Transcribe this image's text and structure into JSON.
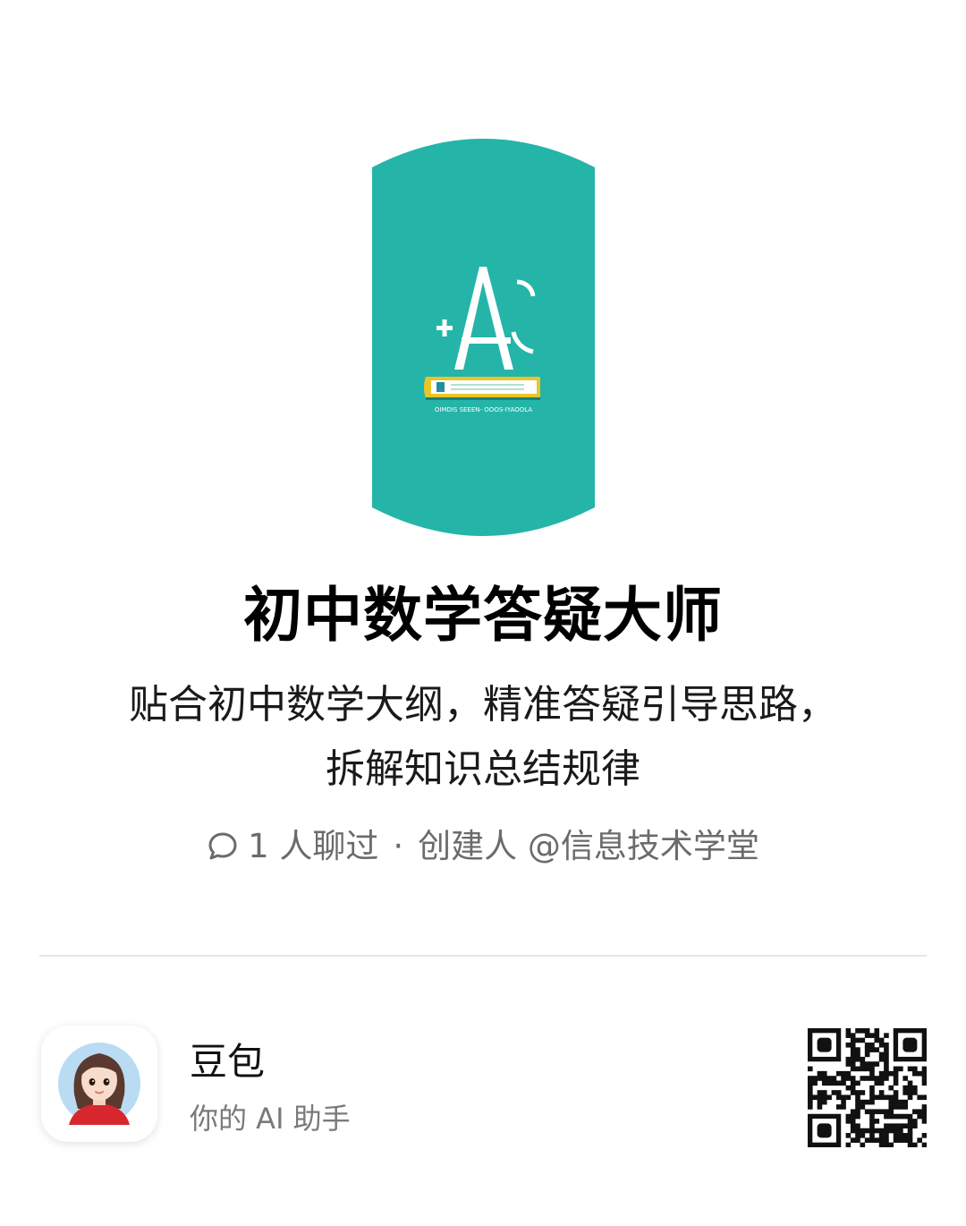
{
  "hero": {
    "image_name": "math-logo-illustration",
    "bg_color": "#25b4a8",
    "logo_caption": "OIMDIS SEEEN- OOOS-IYAOOLA"
  },
  "title": "初中数学答疑大师",
  "description": {
    "line1": "贴合初中数学大纲，精准答疑引导思路，",
    "line2": "拆解知识总结规律"
  },
  "meta": {
    "icon": "chat-bubble-icon",
    "chat_count": "1 人聊过",
    "separator": "·",
    "creator": "创建人 @信息技术学堂"
  },
  "app": {
    "name": "豆包",
    "subtitle": "你的 AI 助手",
    "avatar": "avatar-girl"
  },
  "qr": {
    "icon": "qr-code-icon"
  }
}
